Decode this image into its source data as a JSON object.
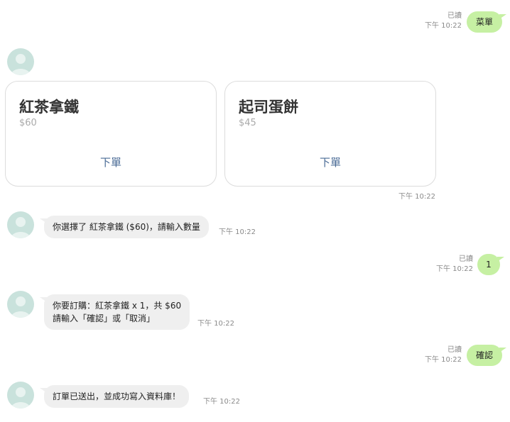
{
  "messages": {
    "m1": {
      "text": "菜單",
      "read": "已讀",
      "time": "下午 10:22"
    },
    "cards": [
      {
        "name": "紅茶拿鐵",
        "price": "$60",
        "action": "下單"
      },
      {
        "name": "起司蛋餅",
        "price": "$45",
        "action": "下單"
      }
    ],
    "cards_time": "下午 10:22",
    "m2": {
      "text": "你選擇了 紅茶拿鐵 ($60)，請輸入數量",
      "time": "下午 10:22"
    },
    "m3": {
      "text": "1",
      "read": "已讀",
      "time": "下午 10:22"
    },
    "m4": {
      "line1": "你要訂購：紅茶拿鐵 x 1，共 $60",
      "line2": "請輸入「確認」或「取消」",
      "time": "下午 10:22"
    },
    "m5": {
      "text": "確認",
      "read": "已讀",
      "time": "下午 10:22"
    },
    "m6": {
      "text": "訂單已送出，並成功寫入資料庫！",
      "time": "下午 10:22"
    }
  },
  "colors": {
    "user_bubble": "#c6f0a3",
    "bot_bubble": "#efefef",
    "avatar": "#c9e2dc",
    "link": "#4a6b96"
  },
  "icons": {
    "avatar": "person-silhouette-icon"
  }
}
